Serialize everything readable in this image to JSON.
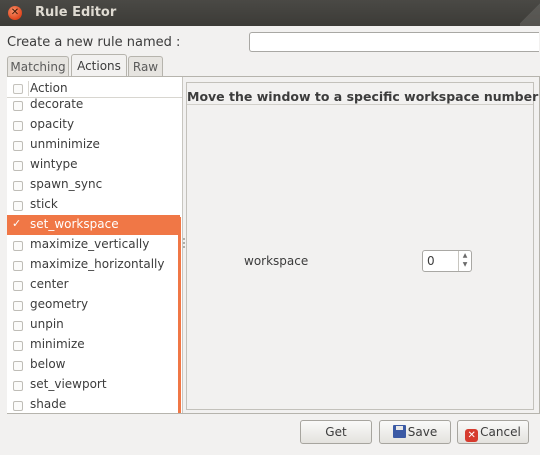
{
  "window": {
    "title": "Rule Editor"
  },
  "form": {
    "name_label": "Create a new rule named :",
    "name_value": ""
  },
  "tabs": [
    {
      "label": "Matching",
      "active": false
    },
    {
      "label": "Actions",
      "active": true
    },
    {
      "label": "Raw",
      "active": false
    }
  ],
  "list": {
    "header": "Action",
    "items": [
      {
        "label": "decorate",
        "checked": false
      },
      {
        "label": "opacity",
        "checked": false
      },
      {
        "label": "unminimize",
        "checked": false
      },
      {
        "label": "wintype",
        "checked": false
      },
      {
        "label": "spawn_sync",
        "checked": false
      },
      {
        "label": "stick",
        "checked": false
      },
      {
        "label": "set_workspace",
        "checked": true,
        "selected": true
      },
      {
        "label": "maximize_vertically",
        "checked": false
      },
      {
        "label": "maximize_horizontally",
        "checked": false
      },
      {
        "label": "center",
        "checked": false
      },
      {
        "label": "geometry",
        "checked": false
      },
      {
        "label": "unpin",
        "checked": false
      },
      {
        "label": "minimize",
        "checked": false
      },
      {
        "label": "below",
        "checked": false
      },
      {
        "label": "set_viewport",
        "checked": false
      },
      {
        "label": "shade",
        "checked": false
      }
    ]
  },
  "detail": {
    "title": "Move the window to a specific workspace number",
    "field_label": "workspace",
    "field_value": "0"
  },
  "buttons": {
    "get": "Get",
    "save": "Save",
    "cancel": "Cancel"
  },
  "colors": {
    "accent": "#f07746",
    "titlebar": "#3c3b37"
  }
}
